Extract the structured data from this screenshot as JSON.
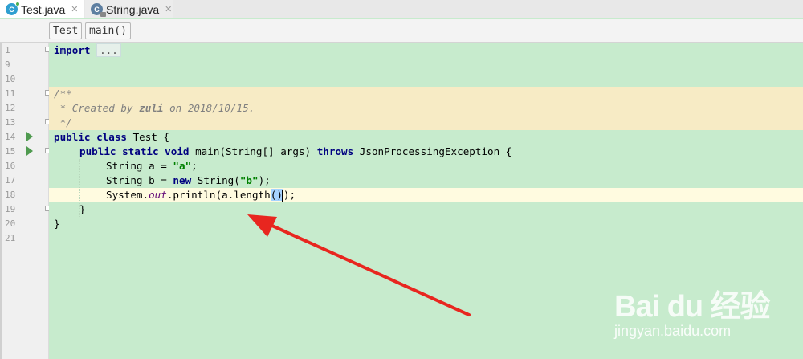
{
  "tabs": [
    {
      "label": "Test.java",
      "icon": "java-class-icon",
      "active": true
    },
    {
      "label": "String.java",
      "icon": "java-class-locked-icon",
      "active": false
    }
  ],
  "breadcrumb": [
    "Test",
    "main()"
  ],
  "lines": {
    "numbers": [
      "1",
      "9",
      "10",
      "11",
      "12",
      "13",
      "14",
      "15",
      "16",
      "17",
      "18",
      "19",
      "20",
      "21"
    ]
  },
  "code": {
    "l1_kw": "import",
    "l1_fold": "...",
    "l11": "/**",
    "l12_a": " * Created by ",
    "l12_b": "zuli",
    "l12_c": " on 2018/10/15.",
    "l13": " */",
    "l14_kw": "public class",
    "l14_rest": " Test {",
    "l15_kw": "public static void",
    "l15_mid": " main(String[] args) ",
    "l15_kw2": "throws",
    "l15_rest": " JsonProcessingException {",
    "l16_a": "String a = ",
    "l16_str": "\"a\"",
    "l16_end": ";",
    "l17_a": "String b = ",
    "l17_kw": "new",
    "l17_b": " String(",
    "l17_str": "\"b\"",
    "l17_end": ");",
    "l18_a": "System.",
    "l18_st": "out",
    "l18_b": ".println(a.length",
    "l18_hl1": "(",
    "l18_hl2": ")",
    "l18_end": ");",
    "l19": "}",
    "l20": "}"
  },
  "watermark": {
    "brand": "Bai du 经验",
    "url": "jingyan.baidu.com"
  }
}
